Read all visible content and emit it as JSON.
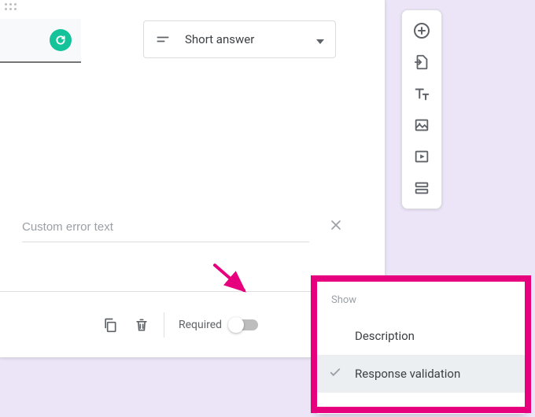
{
  "question_type": {
    "label": "Short answer"
  },
  "error_input": {
    "placeholder": "Custom error text",
    "value": ""
  },
  "footer": {
    "required_label": "Required",
    "required_on": false
  },
  "popup": {
    "section": "Show",
    "items": [
      {
        "label": "Description",
        "selected": false
      },
      {
        "label": "Response validation",
        "selected": true
      }
    ]
  },
  "sidebar": {
    "items": [
      {
        "name": "add-question",
        "icon": "plus-circle"
      },
      {
        "name": "import-questions",
        "icon": "import"
      },
      {
        "name": "add-title",
        "icon": "Tt"
      },
      {
        "name": "add-image",
        "icon": "image"
      },
      {
        "name": "add-video",
        "icon": "video"
      },
      {
        "name": "add-section",
        "icon": "section"
      }
    ]
  }
}
